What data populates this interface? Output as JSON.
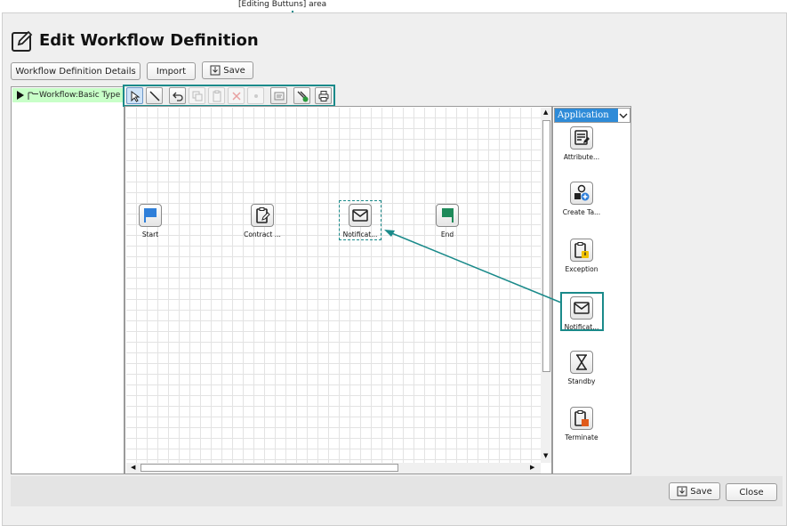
{
  "annotation": {
    "label": "[Editing Buttuns] area"
  },
  "header": {
    "title": "Edit Workflow Definition",
    "title_icon": "edit-icon"
  },
  "toolbar": {
    "details_label": "Workflow Definition Details",
    "import_label": "Import",
    "save_label": "Save"
  },
  "tree": {
    "root_label": "Workflow:Basic Type"
  },
  "editing_buttons": [
    {
      "name": "select-tool",
      "icon": "pointer-icon",
      "state": "selected"
    },
    {
      "name": "line-tool",
      "icon": "line-icon",
      "state": "enabled"
    },
    {
      "name": "undo-button",
      "icon": "undo-icon",
      "state": "enabled"
    },
    {
      "name": "copy-button",
      "icon": "copy-icon",
      "state": "disabled"
    },
    {
      "name": "paste-button",
      "icon": "paste-icon",
      "state": "disabled"
    },
    {
      "name": "delete-button",
      "icon": "delete-icon",
      "state": "disabled"
    },
    {
      "name": "property-button",
      "icon": "dot-icon",
      "state": "disabled"
    },
    {
      "name": "memo-button",
      "icon": "memo-icon",
      "state": "enabled"
    },
    {
      "name": "validate-button",
      "icon": "validate-icon",
      "state": "enabled"
    },
    {
      "name": "print-button",
      "icon": "print-icon",
      "state": "enabled"
    }
  ],
  "canvas": {
    "nodes": [
      {
        "label": "Start",
        "icon": "start-flag-icon"
      },
      {
        "label": "Contract ...",
        "icon": "clipboard-edit-icon"
      },
      {
        "label": "Notificat...",
        "icon": "envelope-icon"
      },
      {
        "label": "End",
        "icon": "end-flag-icon"
      }
    ]
  },
  "palette": {
    "category": "Application",
    "items": [
      {
        "label": "Attribute...",
        "icon": "attribute-icon"
      },
      {
        "label": "Create Ta...",
        "icon": "create-task-icon"
      },
      {
        "label": "Exception",
        "icon": "exception-icon"
      },
      {
        "label": "Notificat...",
        "icon": "envelope-icon"
      },
      {
        "label": "Standby",
        "icon": "hourglass-icon"
      },
      {
        "label": "Terminate",
        "icon": "terminate-icon"
      }
    ]
  },
  "footer": {
    "save_label": "Save",
    "close_label": "Close"
  },
  "colors": {
    "accent": "#1a8a8a",
    "tree_highlight": "#c8ffc8",
    "palette_select": "#2e8bd8"
  }
}
